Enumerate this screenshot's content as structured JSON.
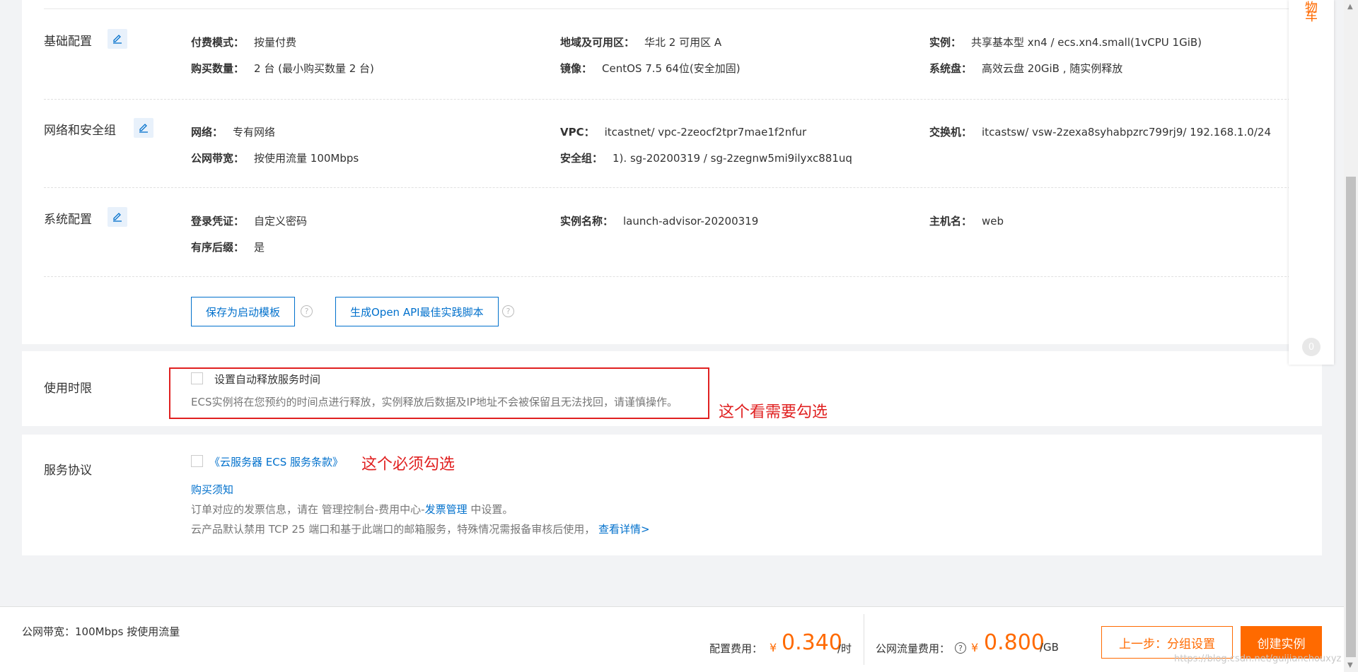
{
  "basic": {
    "title": "基础配置",
    "fields": [
      {
        "k": "付费模式：",
        "v": "按量付费"
      },
      {
        "k": "购买数量：",
        "v": "2 台 (最小购买数量 2 台)"
      },
      {
        "k": "地域及可用区：",
        "v": "华北 2 可用区 A"
      },
      {
        "k": "镜像：",
        "v": "CentOS 7.5 64位(安全加固)"
      },
      {
        "k": "实例：",
        "v": "共享基本型 xn4 / ecs.xn4.small(1vCPU 1GiB)"
      },
      {
        "k": "系统盘：",
        "v": "高效云盘 20GiB , 随实例释放"
      }
    ]
  },
  "network": {
    "title": "网络和安全组",
    "fields": [
      {
        "k": "网络：",
        "v": "专有网络"
      },
      {
        "k": "公网带宽：",
        "v": "按使用流量 100Mbps"
      },
      {
        "k": "VPC：",
        "v": "itcastnet/ vpc-2zeocf2tpr7mae1f2nfur"
      },
      {
        "k": "安全组：",
        "v": "1). sg-20200319 / sg-2zegnw5mi9ilyxc881uq"
      },
      {
        "k": "交换机：",
        "v": "itcastsw/ vsw-2zexa8syhabpzrc799rj9/ 192.168.1.0/24"
      }
    ]
  },
  "system": {
    "title": "系统配置",
    "fields": [
      {
        "k": "登录凭证：",
        "v": "自定义密码"
      },
      {
        "k": "有序后缀：",
        "v": "是"
      },
      {
        "k": "实例名称：",
        "v": "launch-advisor-20200319"
      },
      {
        "k": "主机名：",
        "v": "web"
      }
    ]
  },
  "actions": {
    "save_template": "保存为启动模板",
    "gen_api": "生成Open API最佳实践脚本",
    "help": "?"
  },
  "usage": {
    "title": "使用时限",
    "checkbox_label": "设置自动释放服务时间",
    "note": "ECS实例将在您预约的时间点进行释放，实例释放后数据及IP地址不会被保留且无法找回，请谨慎操作。",
    "annotation": "这个看需要勾选"
  },
  "service": {
    "title": "服务协议",
    "terms_link": "《云服务器 ECS 服务条款》",
    "annotation": "这个必须勾选",
    "purchase_notice": "购买须知",
    "invoice_pre": "订单对应的发票信息，请在 管理控制台-费用中心-",
    "invoice_link": "发票管理",
    "invoice_post": " 中设置。",
    "port_note": "云产品默认禁用 TCP 25 端口和基于此端口的邮箱服务，特殊情况需报备审核后使用，",
    "port_link": "查看详情>"
  },
  "rail": {
    "text_top": "物",
    "text_bottom": "车",
    "badge": "0"
  },
  "footer": {
    "bandwidth": "公网带宽：100Mbps 按使用流量",
    "config_fee_label": "配置费用：",
    "currency": "¥",
    "config_fee": "0.340",
    "config_fee_unit": "/时",
    "traffic_fee_label": "公网流量费用：",
    "help": "?",
    "traffic_fee": "0.800",
    "traffic_fee_unit": "/GB",
    "prev_button": "上一步：分组设置",
    "create_button": "创建实例"
  },
  "watermark": "https://blog.csdn.net/guijianchouxyz"
}
